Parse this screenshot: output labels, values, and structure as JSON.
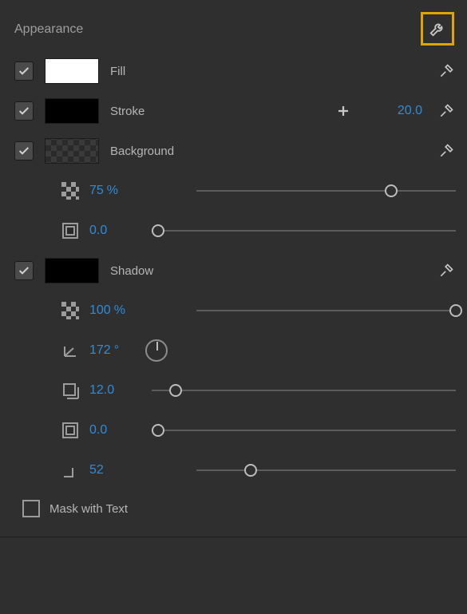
{
  "panel": {
    "title": "Appearance"
  },
  "fill": {
    "enabled": true,
    "label": "Fill",
    "swatch_class": "white"
  },
  "stroke": {
    "enabled": true,
    "label": "Stroke",
    "swatch_class": "black",
    "weight": "20.0"
  },
  "background": {
    "enabled": true,
    "label": "Background",
    "swatch_class": "bg",
    "opacity": "75",
    "opacity_unit": "%",
    "opacity_pct": 75,
    "size": "0.0",
    "size_pct": 2
  },
  "shadow": {
    "enabled": true,
    "label": "Shadow",
    "swatch_class": "black",
    "opacity": "100",
    "opacity_unit": "%",
    "opacity_pct": 100,
    "angle": "172",
    "angle_unit": "°",
    "distance": "12.0",
    "distance_pct": 8,
    "size": "0.0",
    "size_pct": 2,
    "spread": "52",
    "spread_pct": 21
  },
  "mask": {
    "label": "Mask with Text",
    "checked": false
  },
  "icons": {
    "wrench": "wrench-icon",
    "plus": "plus-icon",
    "eyedropper": "eyedropper-icon"
  }
}
